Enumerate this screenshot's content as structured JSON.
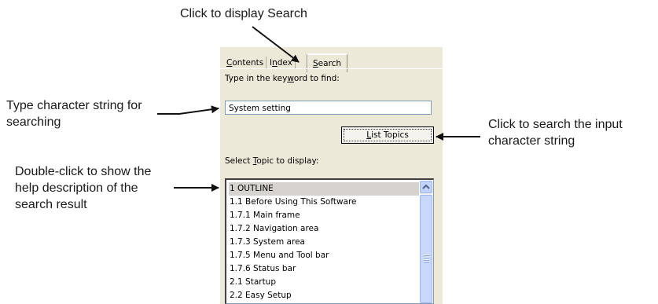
{
  "callouts": {
    "top": "Click to display Search",
    "left_line1": "Type character string for",
    "left_line2": "searching",
    "left2_line1": "Double-click to show the",
    "left2_line2": "help description of the",
    "left2_line3": "search result",
    "right_line1": "Click to search the input",
    "right_line2": "character string"
  },
  "tabs": [
    {
      "pre": "",
      "u": "C",
      "post": "ontents"
    },
    {
      "pre": "I",
      "u": "n",
      "post": "dex"
    },
    {
      "pre": "",
      "u": "S",
      "post": "earch"
    }
  ],
  "search": {
    "prompt_pre": "Type in the key",
    "prompt_u": "w",
    "prompt_post": "ord to find:",
    "keyword": "System setting",
    "list_topics_u": "L",
    "list_topics_post": "ist Topics",
    "topic_pre": "Select ",
    "topic_u": "T",
    "topic_post": "opic to display:"
  },
  "results": [
    "1 OUTLINE",
    "1.1 Before Using This Software",
    "1.7.1 Main frame",
    "1.7.2 Navigation area",
    "1.7.3 System area",
    "1.7.5 Menu and Tool bar",
    "1.7.6 Status bar",
    "2.1 Startup",
    "2.2 Easy Setup"
  ],
  "icons": {
    "scroll_up": "chevron-up-icon",
    "scroll_grip": "grip-icon"
  }
}
